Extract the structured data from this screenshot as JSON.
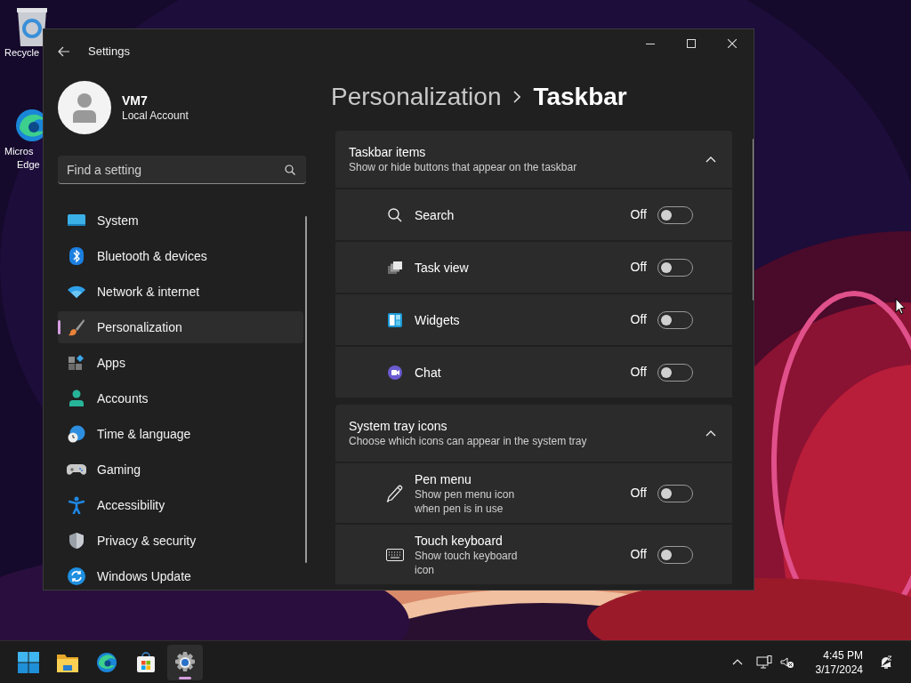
{
  "desktop_icons": [
    {
      "kind": "recycle",
      "lines": [
        "Recycle"
      ]
    },
    {
      "kind": "edge",
      "lines": [
        "Micros",
        "Edge"
      ]
    }
  ],
  "window": {
    "title": "Settings"
  },
  "account": {
    "name": "VM7",
    "type": "Local Account"
  },
  "search": {
    "placeholder": "Find a setting"
  },
  "nav": [
    {
      "kind": "system",
      "label": "System",
      "selected": false
    },
    {
      "kind": "bluetooth",
      "label": "Bluetooth & devices",
      "selected": false
    },
    {
      "kind": "network",
      "label": "Network & internet",
      "selected": false
    },
    {
      "kind": "personalization",
      "label": "Personalization",
      "selected": true
    },
    {
      "kind": "apps",
      "label": "Apps",
      "selected": false
    },
    {
      "kind": "accounts",
      "label": "Accounts",
      "selected": false
    },
    {
      "kind": "time",
      "label": "Time & language",
      "selected": false
    },
    {
      "kind": "gaming",
      "label": "Gaming",
      "selected": false
    },
    {
      "kind": "accessibility",
      "label": "Accessibility",
      "selected": false
    },
    {
      "kind": "privacy",
      "label": "Privacy & security",
      "selected": false
    },
    {
      "kind": "update",
      "label": "Windows Update",
      "selected": false
    }
  ],
  "breadcrumb": [
    "Personalization",
    "Taskbar"
  ],
  "sections": [
    {
      "title": "Taskbar items",
      "description": "Show or hide buttons that appear on the taskbar",
      "expanded": true,
      "items": [
        {
          "kind": "search",
          "label": "Search",
          "state_text": "Off",
          "on": false
        },
        {
          "kind": "taskview",
          "label": "Task view",
          "state_text": "Off",
          "on": false
        },
        {
          "kind": "widgets",
          "label": "Widgets",
          "state_text": "Off",
          "on": false
        },
        {
          "kind": "chat",
          "label": "Chat",
          "state_text": "Off",
          "on": false
        }
      ]
    },
    {
      "title": "System tray icons",
      "description": "Choose which icons can appear in the system tray",
      "expanded": true,
      "items": [
        {
          "kind": "pen",
          "label": "Pen menu",
          "description": "Show pen menu icon when pen is in use",
          "state_text": "Off",
          "on": false
        },
        {
          "kind": "keyboard",
          "label": "Touch keyboard",
          "description": "Show touch keyboard icon",
          "state_text": "Off",
          "on": false
        }
      ]
    }
  ],
  "taskbar": {
    "apps": [
      {
        "kind": "start",
        "selected": false
      },
      {
        "kind": "explorer",
        "selected": false
      },
      {
        "kind": "edge",
        "selected": false
      },
      {
        "kind": "store",
        "selected": false
      },
      {
        "kind": "settings",
        "selected": true
      }
    ],
    "clock": {
      "time": "4:45 PM",
      "date": "3/17/2024"
    }
  }
}
